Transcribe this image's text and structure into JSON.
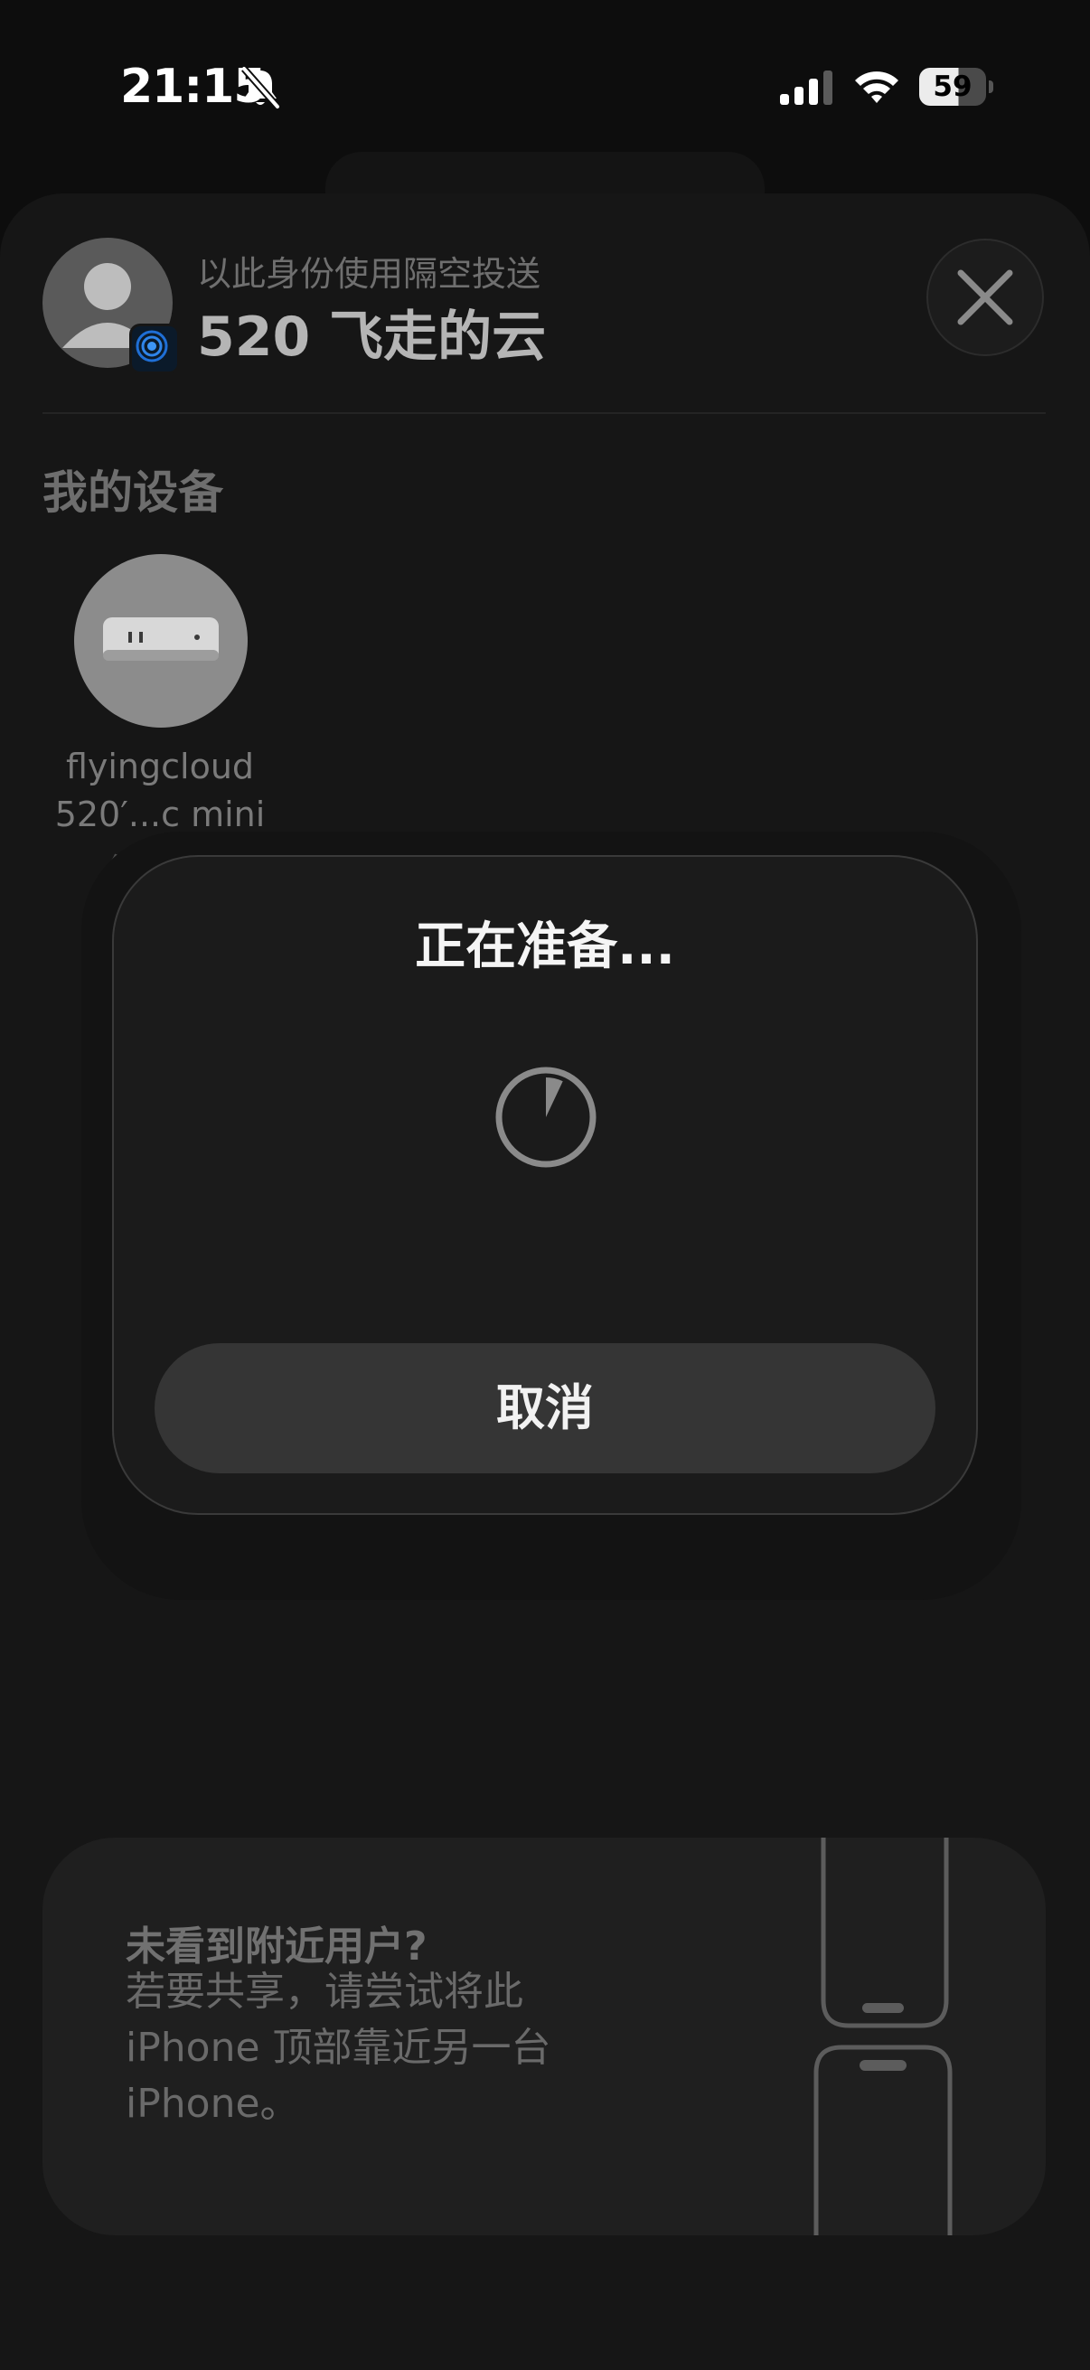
{
  "status_bar": {
    "time": "21:15",
    "battery_level": "59",
    "icons": [
      "bell-slash-icon",
      "cellular-signal-icon",
      "wifi-icon",
      "battery-icon"
    ]
  },
  "header": {
    "subtitle": "以此身份使用隔空投送",
    "title": "520 飞走的云",
    "avatar_icon": "person-icon",
    "badge_icon": "airdrop-icon",
    "close_icon": "xmark-icon"
  },
  "my_devices": {
    "section_title": "我的设备",
    "devices": [
      {
        "name_line1": "flyingcloud",
        "name_line2": "520′...c mini",
        "status": "等待中",
        "icon": "mac-mini-icon"
      }
    ]
  },
  "dialog": {
    "title": "正在准备...",
    "progress": 0.07,
    "cancel_label": "取消"
  },
  "hint": {
    "title": "未看到附近用户?",
    "body": "若要共享，请尝试将此 iPhone 顶部靠近另一台 iPhone。",
    "illustration_icon": "two-iphones-icon"
  },
  "colors": {
    "background": "#0d0d0d",
    "sheet": "#161616",
    "dialog": "#1b1b1b",
    "button": "#353535"
  }
}
